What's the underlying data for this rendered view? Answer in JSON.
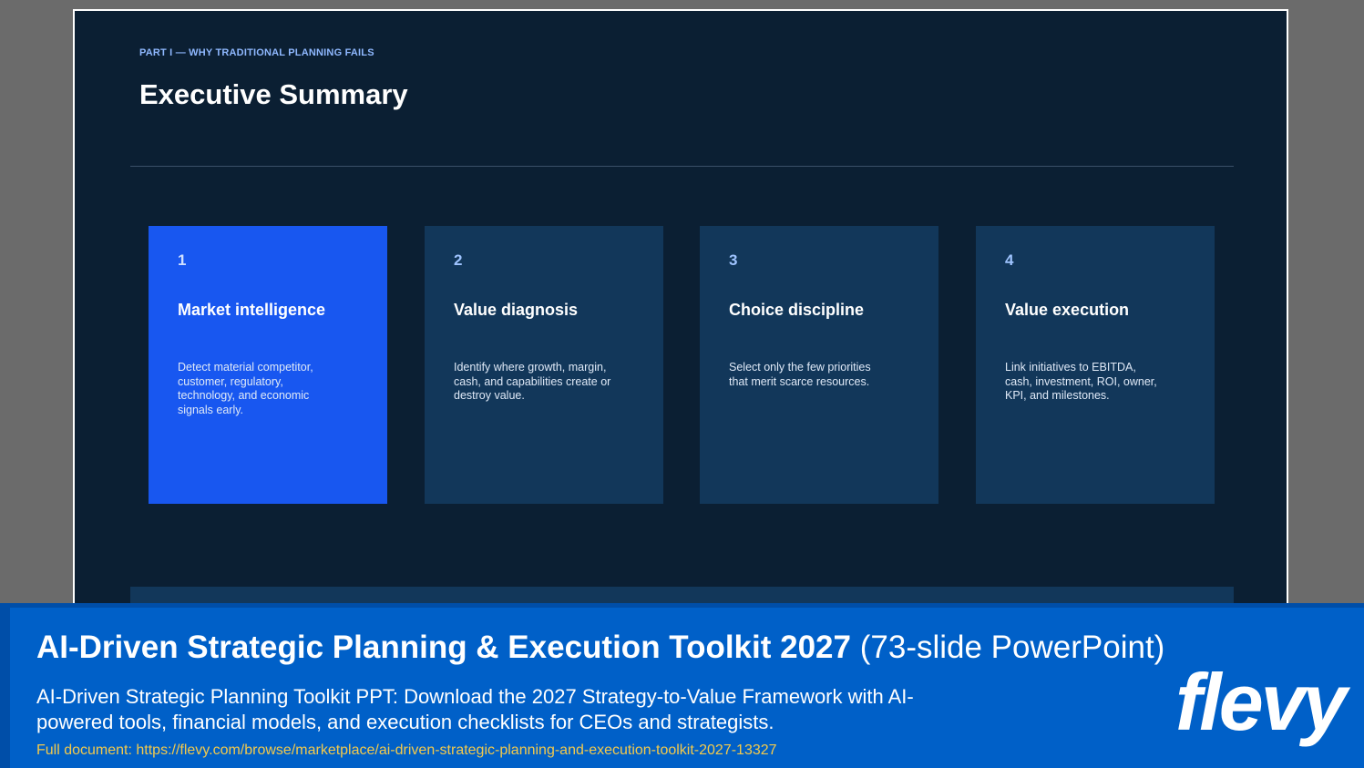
{
  "slide": {
    "kicker": "PART I — WHY TRADITIONAL PLANNING FAILS",
    "title": "Executive Summary",
    "cards": [
      {
        "number": "1",
        "heading": "Market intelligence",
        "description": "Detect material competitor, customer, regulatory, technology, and economic signals early."
      },
      {
        "number": "2",
        "heading": "Value diagnosis",
        "description": "Identify where growth, margin, cash, and capabilities create or destroy value."
      },
      {
        "number": "3",
        "heading": "Choice discipline",
        "description": "Select only the few priorities that merit scarce resources."
      },
      {
        "number": "4",
        "heading": "Value execution",
        "description": "Link initiatives to EBITDA, cash, investment, ROI, owner, KPI, and milestones."
      }
    ]
  },
  "banner": {
    "title": "AI-Driven Strategic Planning & Execution Toolkit 2027",
    "title_suffix": "(73-slide PowerPoint)",
    "description": "AI-Driven Strategic Planning Toolkit PPT: Download the 2027 Strategy-to-Value Framework with AI-powered tools, financial models, and execution checklists for CEOs and strategists.",
    "link": "Full document: https://flevy.com/browse/marketplace/ai-driven-strategic-planning-and-execution-toolkit-2027-13327",
    "logo": "flevy"
  },
  "colors": {
    "slide_bg": "#0b1f33",
    "card_bg": "#12375a",
    "card_active_bg": "#1857f0",
    "banner_bg": "#0060c8",
    "link_color": "#f2c94c"
  }
}
